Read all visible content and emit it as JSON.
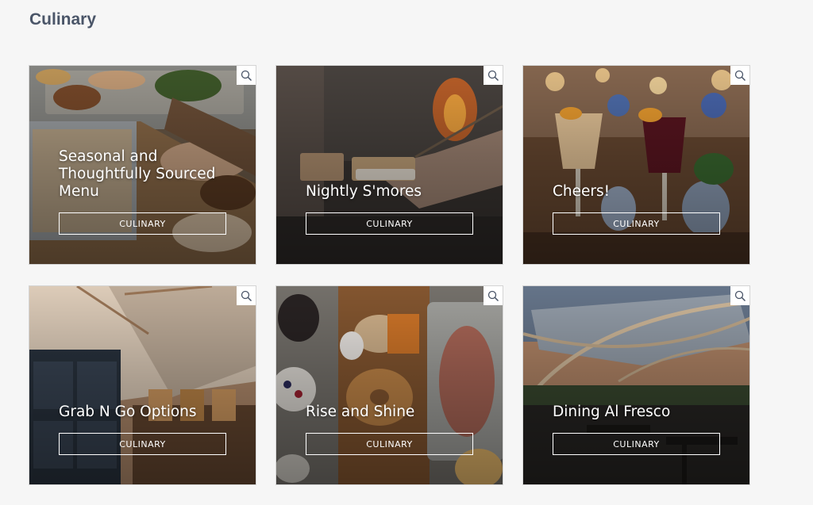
{
  "page": {
    "title": "Culinary"
  },
  "cards": [
    {
      "title": "Seasonal and Thoughtfully Sourced Menu",
      "tag": "CULINARY",
      "icon": "zoom-icon"
    },
    {
      "title": "Nightly S'mores",
      "tag": "CULINARY",
      "icon": "zoom-icon"
    },
    {
      "title": "Cheers!",
      "tag": "CULINARY",
      "icon": "zoom-icon"
    },
    {
      "title": "Grab N Go Options",
      "tag": "CULINARY",
      "icon": "zoom-icon"
    },
    {
      "title": "Rise and Shine",
      "tag": "CULINARY",
      "icon": "zoom-icon"
    },
    {
      "title": "Dining Al Fresco",
      "tag": "CULINARY",
      "icon": "zoom-icon"
    }
  ],
  "colors": {
    "heading": "#4a5568",
    "background": "#f6f6f6",
    "overlay_text": "#ffffff"
  }
}
